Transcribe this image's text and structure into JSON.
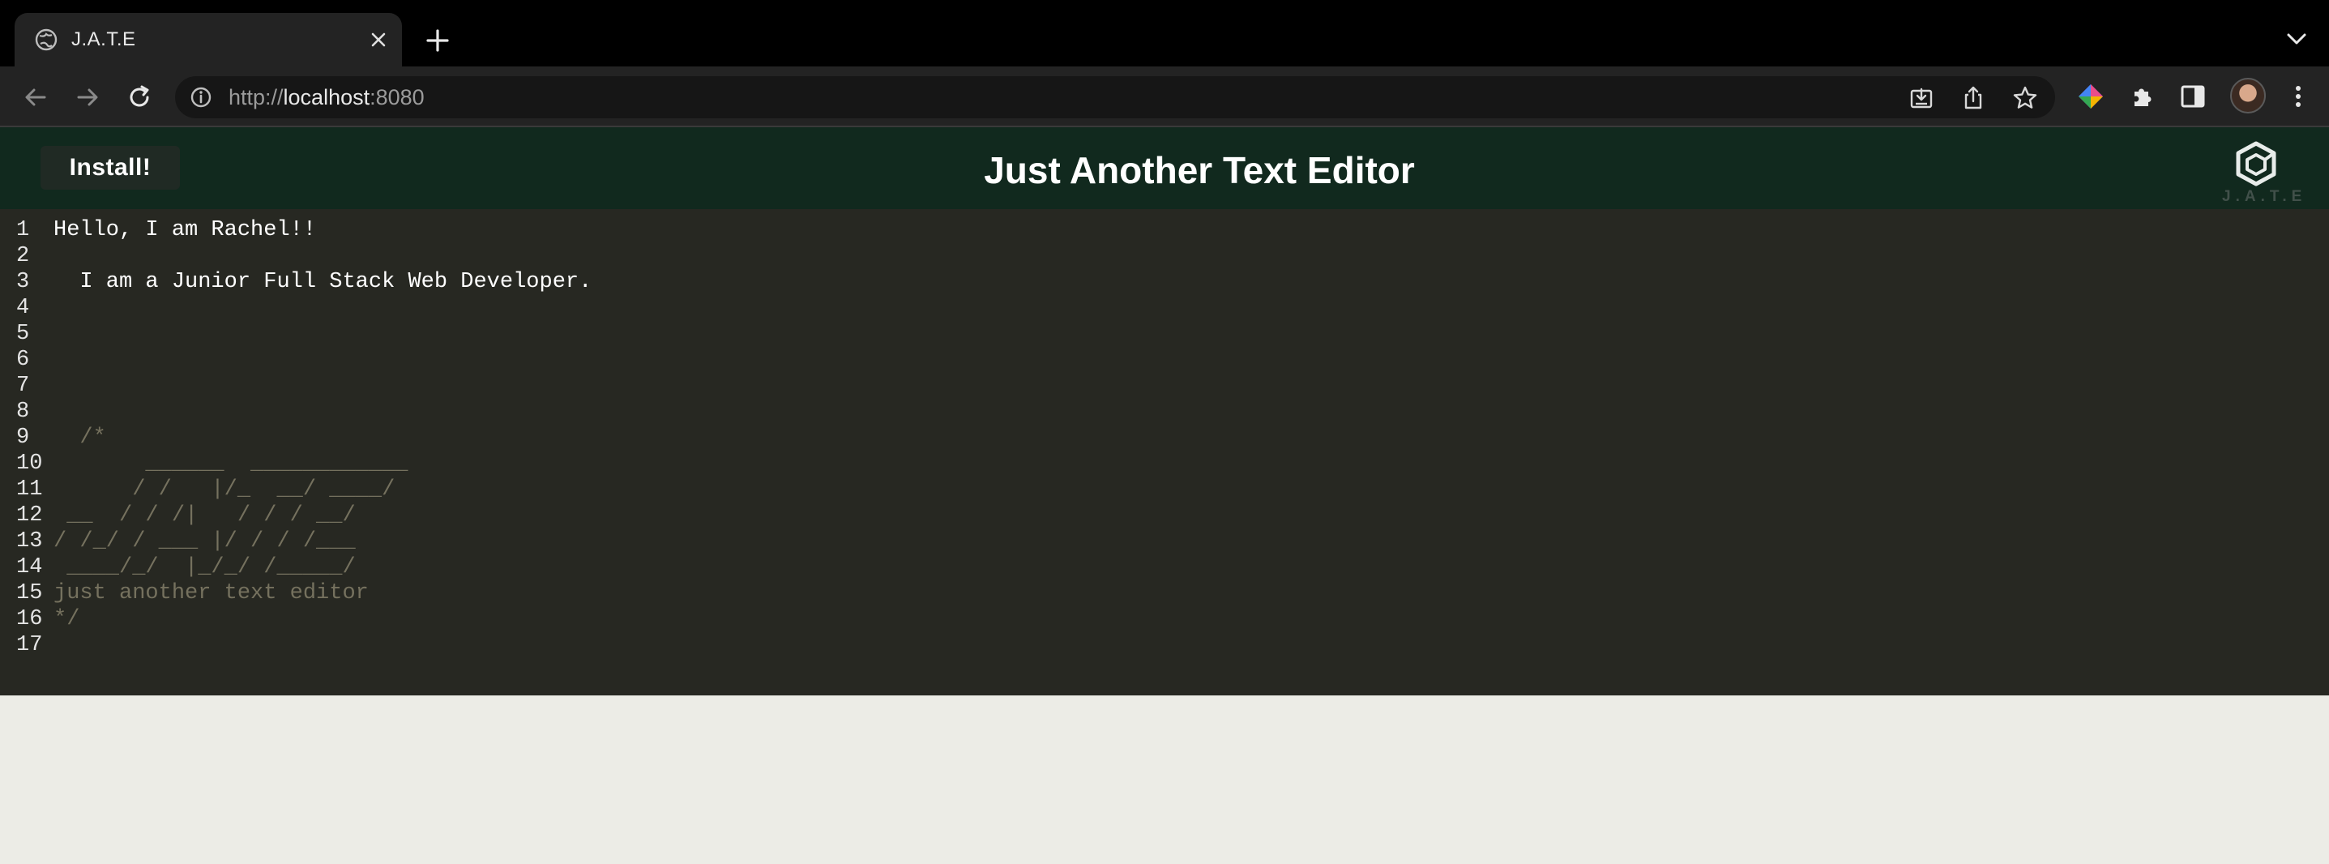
{
  "browser": {
    "tab_title": "J.A.T.E",
    "url_prefix": "http://",
    "url_host": "localhost",
    "url_port": ":8080"
  },
  "app": {
    "install_label": "Install!",
    "title": "Just Another Text Editor",
    "logo_text": "J.A.T.E",
    "header_color": "#11291e",
    "editor_bg": "#272822"
  },
  "editor": {
    "lines": [
      {
        "n": "1",
        "text": "Hello, I am Rachel!!"
      },
      {
        "n": "2",
        "text": ""
      },
      {
        "n": "3",
        "text": "  I am a Junior Full Stack Web Developer."
      },
      {
        "n": "4",
        "text": ""
      },
      {
        "n": "5",
        "text": ""
      },
      {
        "n": "6",
        "text": ""
      },
      {
        "n": "7",
        "text": ""
      },
      {
        "n": "8",
        "text": ""
      },
      {
        "n": "9",
        "text": "  /*"
      },
      {
        "n": "10",
        "text": "       ______  ____________"
      },
      {
        "n": "11",
        "text": "      / /   |/_  __/ ____/"
      },
      {
        "n": "12",
        "text": " __  / / /|   / / / __/"
      },
      {
        "n": "13",
        "text": "/ /_/ / ___ |/ / / /___"
      },
      {
        "n": "14",
        "text": " ____/_/  |_/_/ /_____/"
      },
      {
        "n": "15",
        "text": "just another text editor"
      },
      {
        "n": "16",
        "text": "*/"
      },
      {
        "n": "17",
        "text": ""
      }
    ]
  }
}
